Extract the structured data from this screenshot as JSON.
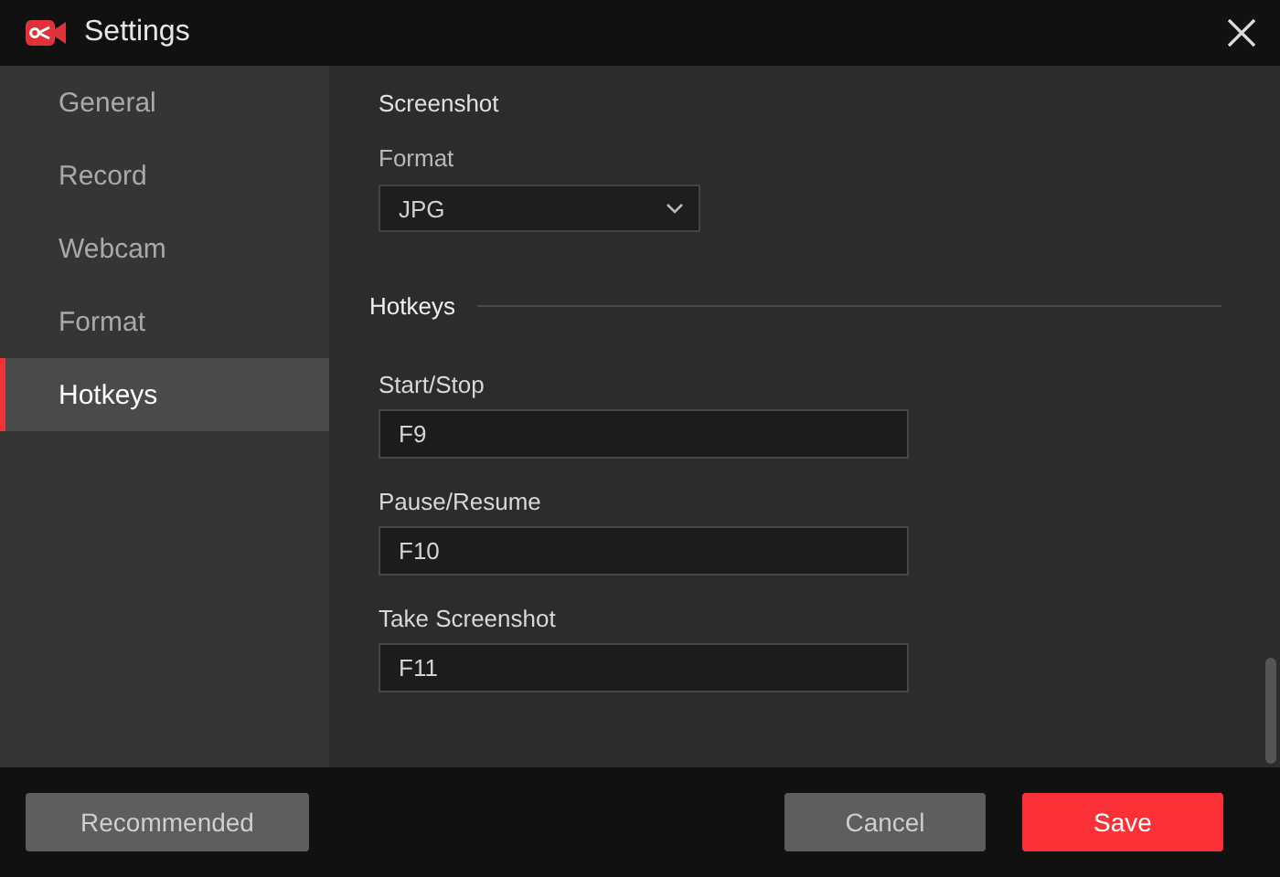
{
  "window": {
    "title": "Settings"
  },
  "sidebar": {
    "items": [
      {
        "label": "General",
        "selected": false
      },
      {
        "label": "Record",
        "selected": false
      },
      {
        "label": "Webcam",
        "selected": false
      },
      {
        "label": "Format",
        "selected": false
      },
      {
        "label": "Hotkeys",
        "selected": true
      }
    ]
  },
  "screenshot": {
    "heading": "Screenshot",
    "format_label": "Format",
    "format_value": "JPG"
  },
  "hotkeys": {
    "heading": "Hotkeys",
    "fields": [
      {
        "label": "Start/Stop",
        "value": "F9"
      },
      {
        "label": "Pause/Resume",
        "value": "F10"
      },
      {
        "label": "Take Screenshot",
        "value": "F11"
      }
    ]
  },
  "buttons": {
    "recommended": "Recommended",
    "cancel": "Cancel",
    "save": "Save"
  }
}
